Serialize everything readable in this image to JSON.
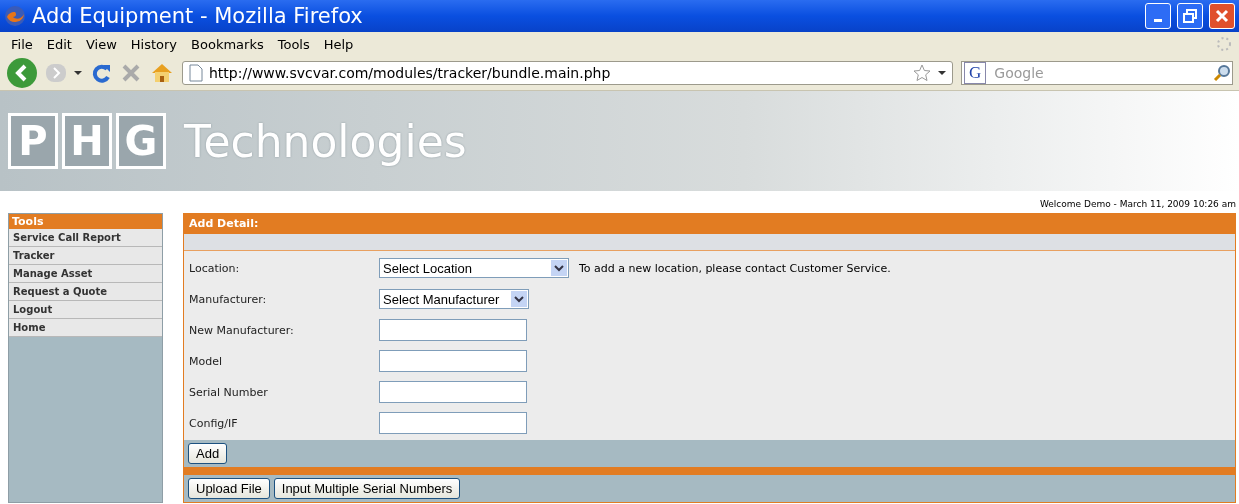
{
  "window": {
    "title": "Add Equipment - Mozilla Firefox"
  },
  "menu": [
    "File",
    "Edit",
    "View",
    "History",
    "Bookmarks",
    "Tools",
    "Help"
  ],
  "address_bar": {
    "value": "http://www.svcvar.com/modules/tracker/bundle.main.php"
  },
  "search": {
    "engine": "G",
    "placeholder": "Google"
  },
  "logo": {
    "letters": [
      "P",
      "H",
      "G"
    ],
    "name": "Technologies"
  },
  "welcome": "Welcome Demo - March 11, 2009 10:26 am",
  "sidebar": {
    "title": "Tools",
    "items": [
      "Service Call Report",
      "Tracker",
      "Manage Asset",
      "Request a Quote",
      "Logout",
      "Home"
    ]
  },
  "panel": {
    "title": "Add Detail:",
    "fields": [
      {
        "label": "Location:",
        "kind": "select",
        "value": "Select Location",
        "note": "To add a new location, please contact Customer Service."
      },
      {
        "label": "Manufacturer:",
        "kind": "select",
        "value": "Select Manufacturer"
      },
      {
        "label": "New Manufacturer:",
        "kind": "text"
      },
      {
        "label": "Model",
        "kind": "text"
      },
      {
        "label": "Serial Number",
        "kind": "text"
      },
      {
        "label": "Config/IF",
        "kind": "text"
      }
    ],
    "add_button": "Add",
    "bottom_buttons": [
      "Upload File",
      "Input Multiple Serial Numbers"
    ]
  }
}
